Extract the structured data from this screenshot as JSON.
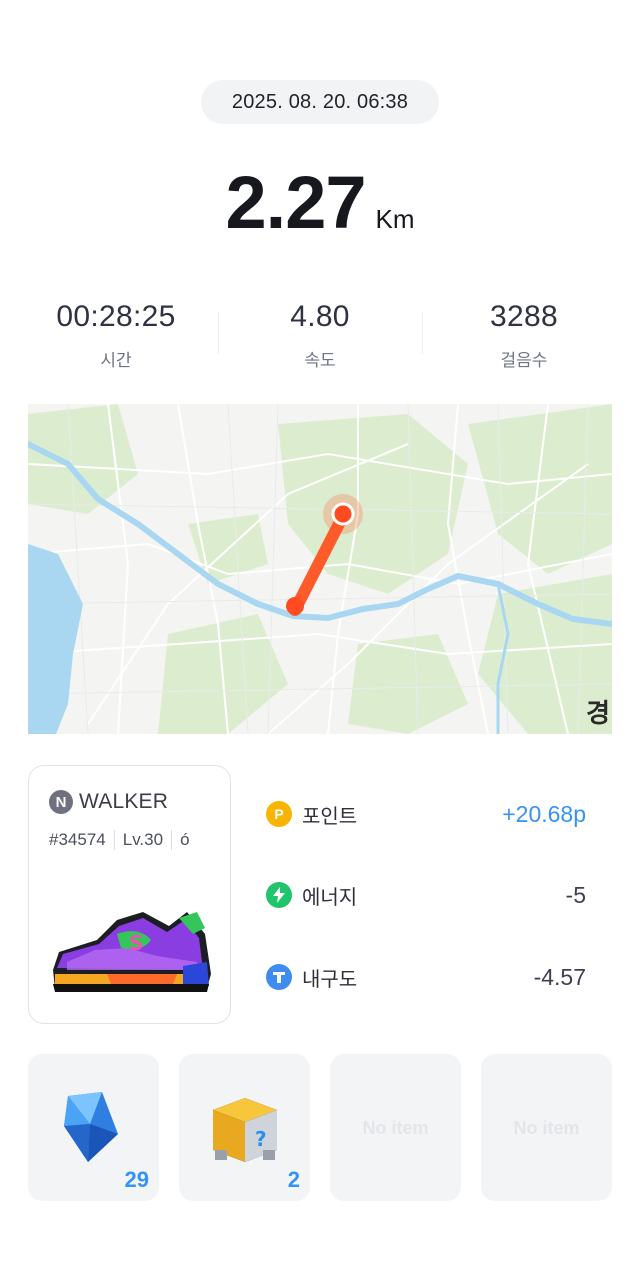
{
  "record": {
    "datetime": "2025. 08. 20. 06:38",
    "distance": "2.27",
    "distance_unit": "Km"
  },
  "stats": [
    {
      "value": "00:28:25",
      "label": "시간"
    },
    {
      "value": "4.80",
      "label": "속도"
    },
    {
      "value": "3288",
      "label": "걸음수"
    }
  ],
  "map": {
    "corner_text": "경",
    "route_color": "#ff5a2a",
    "water_color": "#a9d7f2",
    "park_color": "#dcedcf"
  },
  "nft": {
    "logo_letter": "N",
    "name": "WALKER",
    "id": "#34574",
    "level": "Lv.30",
    "extra_icon": "ó",
    "image": "sneaker-icon"
  },
  "rewards": [
    {
      "icon": "point-icon",
      "icon_letter": "P",
      "icon_color": "#f8b400",
      "label": "포인트",
      "value": "+20.68p",
      "positive": true
    },
    {
      "icon": "energy-icon",
      "icon_letter": "",
      "icon_color": "#20c46a",
      "label": "에너지",
      "value": "-5",
      "positive": false
    },
    {
      "icon": "durability-icon",
      "icon_letter": "",
      "icon_color": "#3f8cf0",
      "label": "내구도",
      "value": "-4.57",
      "positive": false
    }
  ],
  "items": [
    {
      "icon": "gem-icon",
      "count": "29",
      "empty_label": ""
    },
    {
      "icon": "mystery-box-icon",
      "count": "2",
      "empty_label": ""
    },
    {
      "icon": "",
      "count": "",
      "empty_label": "No item"
    },
    {
      "icon": "",
      "count": "",
      "empty_label": "No item"
    }
  ]
}
